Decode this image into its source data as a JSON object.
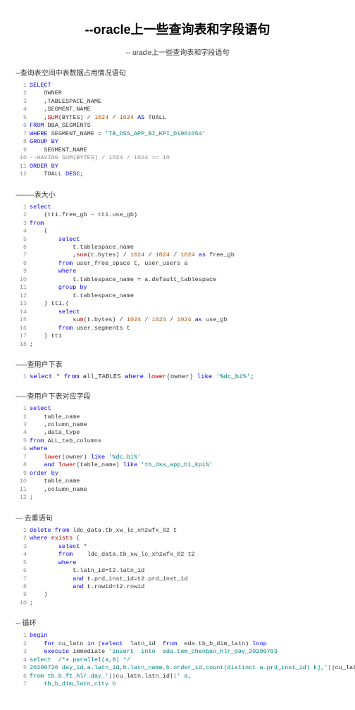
{
  "title": "--oracle上一些查询表和字段语句",
  "subtitle": "-- oracle上一些查询表和字段语句",
  "sections": {
    "s1_header": "--查询表空间中表数据占用情况语句",
    "s1_lines": [
      {
        "n": "1",
        "parts": [
          {
            "c": "kw",
            "t": "SELECT"
          }
        ]
      },
      {
        "n": "2",
        "parts": [
          {
            "c": "plain",
            "t": "    OWNER"
          }
        ]
      },
      {
        "n": "3",
        "parts": [
          {
            "c": "plain",
            "t": "    ,TABLESPACE_NAME"
          }
        ]
      },
      {
        "n": "4",
        "parts": [
          {
            "c": "plain",
            "t": "    ,SEGMENT_NAME"
          }
        ]
      },
      {
        "n": "5",
        "parts": [
          {
            "c": "plain",
            "t": "    ,"
          },
          {
            "c": "fn",
            "t": "SUM"
          },
          {
            "c": "plain",
            "t": "(BYTES) / "
          },
          {
            "c": "num",
            "t": "1024"
          },
          {
            "c": "plain",
            "t": " / "
          },
          {
            "c": "num",
            "t": "1024"
          },
          {
            "c": "plain",
            "t": " "
          },
          {
            "c": "kw",
            "t": "AS"
          },
          {
            "c": "plain",
            "t": " TOALL"
          }
        ]
      },
      {
        "n": "6",
        "parts": [
          {
            "c": "kw",
            "t": "FROM"
          },
          {
            "c": "plain",
            "t": " DBA_SEGMENTS"
          }
        ]
      },
      {
        "n": "7",
        "parts": [
          {
            "c": "kw",
            "t": "WHERE"
          },
          {
            "c": "plain",
            "t": " SEGMENT_NAME = "
          },
          {
            "c": "str",
            "t": "'TB_DSS_APP_BI_KPI_D1901054'"
          }
        ]
      },
      {
        "n": "8",
        "parts": [
          {
            "c": "kw",
            "t": "GROUP BY"
          }
        ]
      },
      {
        "n": "9",
        "parts": [
          {
            "c": "plain",
            "t": "    SEGMENT_NAME"
          }
        ]
      },
      {
        "n": "10",
        "parts": [
          {
            "c": "comment",
            "t": "--HAVING SUM(BYTES) / 1024 / 1024 >= 10"
          }
        ]
      },
      {
        "n": "11",
        "parts": [
          {
            "c": "kw",
            "t": "ORDER BY"
          }
        ]
      },
      {
        "n": "12",
        "parts": [
          {
            "c": "plain",
            "t": "    TOALL "
          },
          {
            "c": "kw",
            "t": "DESC"
          },
          {
            "c": "plain",
            "t": ";"
          }
        ]
      }
    ],
    "s2_header": "--------表大小",
    "s2_lines": [
      {
        "n": "1",
        "parts": [
          {
            "c": "kw",
            "t": "select"
          }
        ]
      },
      {
        "n": "2",
        "parts": [
          {
            "c": "plain",
            "t": "    (tt1.free_gb – tt1.use_gb)"
          }
        ]
      },
      {
        "n": "3",
        "parts": [
          {
            "c": "kw",
            "t": "from"
          }
        ]
      },
      {
        "n": "4",
        "parts": [
          {
            "c": "plain",
            "t": "    ("
          }
        ]
      },
      {
        "n": "5",
        "parts": [
          {
            "c": "plain",
            "t": "        "
          },
          {
            "c": "kw",
            "t": "select"
          }
        ]
      },
      {
        "n": "6",
        "parts": [
          {
            "c": "plain",
            "t": "            t.tablespace_name"
          }
        ]
      },
      {
        "n": "7",
        "parts": [
          {
            "c": "plain",
            "t": "            ,"
          },
          {
            "c": "fn",
            "t": "sum"
          },
          {
            "c": "plain",
            "t": "(t.bytes) / "
          },
          {
            "c": "num",
            "t": "1024"
          },
          {
            "c": "plain",
            "t": " / "
          },
          {
            "c": "num",
            "t": "1024"
          },
          {
            "c": "plain",
            "t": " / "
          },
          {
            "c": "num",
            "t": "1024"
          },
          {
            "c": "plain",
            "t": " "
          },
          {
            "c": "kw",
            "t": "as"
          },
          {
            "c": "plain",
            "t": " free_gb"
          }
        ]
      },
      {
        "n": "8",
        "parts": [
          {
            "c": "plain",
            "t": "        "
          },
          {
            "c": "kw",
            "t": "from"
          },
          {
            "c": "plain",
            "t": " user_free_space t, user_users a"
          }
        ]
      },
      {
        "n": "9",
        "parts": [
          {
            "c": "plain",
            "t": "        "
          },
          {
            "c": "kw",
            "t": "where"
          }
        ]
      },
      {
        "n": "10",
        "parts": [
          {
            "c": "plain",
            "t": "            t.tablespace_name = a.default_tablespace"
          }
        ]
      },
      {
        "n": "11",
        "parts": [
          {
            "c": "plain",
            "t": "        "
          },
          {
            "c": "kw",
            "t": "group by"
          }
        ]
      },
      {
        "n": "12",
        "parts": [
          {
            "c": "plain",
            "t": "            t.tablespace_name"
          }
        ]
      },
      {
        "n": "13",
        "parts": [
          {
            "c": "plain",
            "t": "    ) tt1,("
          }
        ]
      },
      {
        "n": "14",
        "parts": [
          {
            "c": "plain",
            "t": "        "
          },
          {
            "c": "kw",
            "t": "select"
          }
        ]
      },
      {
        "n": "15",
        "parts": [
          {
            "c": "plain",
            "t": "            "
          },
          {
            "c": "fn",
            "t": "sum"
          },
          {
            "c": "plain",
            "t": "(t.bytes) / "
          },
          {
            "c": "num",
            "t": "1024"
          },
          {
            "c": "plain",
            "t": " / "
          },
          {
            "c": "num",
            "t": "1024"
          },
          {
            "c": "plain",
            "t": " / "
          },
          {
            "c": "num",
            "t": "1024"
          },
          {
            "c": "plain",
            "t": " "
          },
          {
            "c": "kw",
            "t": "as"
          },
          {
            "c": "plain",
            "t": " use_gb"
          }
        ]
      },
      {
        "n": "16",
        "parts": [
          {
            "c": "plain",
            "t": "        "
          },
          {
            "c": "kw",
            "t": "from"
          },
          {
            "c": "plain",
            "t": " user_segments t"
          }
        ]
      },
      {
        "n": "17",
        "parts": [
          {
            "c": "plain",
            "t": "    ) tt1"
          }
        ]
      },
      {
        "n": "18",
        "parts": [
          {
            "c": "plain",
            "t": ";"
          }
        ]
      }
    ],
    "s3_header": "-----查用户下表",
    "s3_query_parts": [
      {
        "c": "ln",
        "t": "1 "
      },
      {
        "c": "kw",
        "t": "select"
      },
      {
        "c": "plain",
        "t": " * "
      },
      {
        "c": "kw",
        "t": "from"
      },
      {
        "c": "plain",
        "t": " all_TABLES "
      },
      {
        "c": "kw",
        "t": "where"
      },
      {
        "c": "plain",
        "t": " "
      },
      {
        "c": "fn",
        "t": "lower"
      },
      {
        "c": "plain",
        "t": "(owner) "
      },
      {
        "c": "kw",
        "t": "like"
      },
      {
        "c": "plain",
        "t": " "
      },
      {
        "c": "str",
        "t": "'%dc_bi%'"
      },
      {
        "c": "plain",
        "t": ";"
      }
    ],
    "s4_header": "-----查用户下表对应字段",
    "s4_lines": [
      {
        "n": "1",
        "parts": [
          {
            "c": "kw",
            "t": "select"
          }
        ]
      },
      {
        "n": "2",
        "parts": [
          {
            "c": "plain",
            "t": "    table_name"
          }
        ]
      },
      {
        "n": "3",
        "parts": [
          {
            "c": "plain",
            "t": "    ,column_name"
          }
        ]
      },
      {
        "n": "4",
        "parts": [
          {
            "c": "plain",
            "t": "    ,data_type"
          }
        ]
      },
      {
        "n": "5",
        "parts": [
          {
            "c": "kw",
            "t": "from"
          },
          {
            "c": "plain",
            "t": " ALL_tab_columns"
          }
        ]
      },
      {
        "n": "6",
        "parts": [
          {
            "c": "kw",
            "t": "where"
          }
        ]
      },
      {
        "n": "7",
        "parts": [
          {
            "c": "plain",
            "t": "    "
          },
          {
            "c": "fn",
            "t": "lower"
          },
          {
            "c": "plain",
            "t": "(owner) "
          },
          {
            "c": "kw",
            "t": "like"
          },
          {
            "c": "plain",
            "t": " "
          },
          {
            "c": "str",
            "t": "'%dc_bi%'"
          }
        ]
      },
      {
        "n": "8",
        "parts": [
          {
            "c": "plain",
            "t": "    "
          },
          {
            "c": "kw",
            "t": "and"
          },
          {
            "c": "plain",
            "t": " "
          },
          {
            "c": "fn",
            "t": "lower"
          },
          {
            "c": "plain",
            "t": "(table_name) "
          },
          {
            "c": "kw",
            "t": "like"
          },
          {
            "c": "plain",
            "t": " "
          },
          {
            "c": "str",
            "t": "'tb_dss_app_bi_kpi%'"
          }
        ]
      },
      {
        "n": "9",
        "parts": [
          {
            "c": "kw",
            "t": "order by"
          }
        ]
      },
      {
        "n": "10",
        "parts": [
          {
            "c": "plain",
            "t": "    table_name"
          }
        ]
      },
      {
        "n": "11",
        "parts": [
          {
            "c": "plain",
            "t": "    ,column_name"
          }
        ]
      },
      {
        "n": "12",
        "parts": [
          {
            "c": "plain",
            "t": ";"
          }
        ]
      }
    ],
    "s5_header": "--- 去重语句",
    "s5_lines": [
      {
        "n": "1",
        "parts": [
          {
            "c": "kw",
            "t": "delete from"
          },
          {
            "c": "plain",
            "t": " ldc_data.tb_xw_lc_xhzwfx_02 t"
          }
        ]
      },
      {
        "n": "2",
        "parts": [
          {
            "c": "kw",
            "t": "where"
          },
          {
            "c": "plain",
            "t": " "
          },
          {
            "c": "fn",
            "t": "exists"
          },
          {
            "c": "plain",
            "t": " ("
          }
        ]
      },
      {
        "n": "3",
        "parts": [
          {
            "c": "plain",
            "t": "        "
          },
          {
            "c": "kw",
            "t": "select"
          },
          {
            "c": "plain",
            "t": " *"
          }
        ]
      },
      {
        "n": "4",
        "parts": [
          {
            "c": "plain",
            "t": "        "
          },
          {
            "c": "kw",
            "t": "from"
          },
          {
            "c": "plain",
            "t": "    ldc_data.tb_xw_lc_xhzwfx_02 t2"
          }
        ]
      },
      {
        "n": "5",
        "parts": [
          {
            "c": "plain",
            "t": "        "
          },
          {
            "c": "kw",
            "t": "where"
          }
        ]
      },
      {
        "n": "6",
        "parts": [
          {
            "c": "plain",
            "t": "            t.latn_id=t2.latn_id"
          }
        ]
      },
      {
        "n": "7",
        "parts": [
          {
            "c": "plain",
            "t": "            "
          },
          {
            "c": "kw",
            "t": "and"
          },
          {
            "c": "plain",
            "t": " t.prd_inst_id=t2.prd_inst_id"
          }
        ]
      },
      {
        "n": "8",
        "parts": [
          {
            "c": "plain",
            "t": "            "
          },
          {
            "c": "kw",
            "t": "and"
          },
          {
            "c": "plain",
            "t": " t.rowid<t2.rowid"
          }
        ]
      },
      {
        "n": "9",
        "parts": [
          {
            "c": "plain",
            "t": "    )"
          }
        ]
      },
      {
        "n": "10",
        "parts": [
          {
            "c": "plain",
            "t": ";"
          }
        ]
      }
    ],
    "s6_header": "--   循环",
    "s6_lines": [
      {
        "n": "1",
        "parts": [
          {
            "c": "kw",
            "t": "begin"
          }
        ]
      },
      {
        "n": "2",
        "parts": [
          {
            "c": "plain",
            "t": "    "
          },
          {
            "c": "kw",
            "t": "for"
          },
          {
            "c": "plain",
            "t": " cu_latn "
          },
          {
            "c": "kw",
            "t": "in"
          },
          {
            "c": "plain",
            "t": " ("
          },
          {
            "c": "kw",
            "t": "select"
          },
          {
            "c": "plain",
            "t": "  latn_id  "
          },
          {
            "c": "kw",
            "t": "from"
          },
          {
            "c": "plain",
            "t": "  eda.tb_b_dim_latn) "
          },
          {
            "c": "kw",
            "t": "loop"
          }
        ]
      },
      {
        "n": "3",
        "parts": [
          {
            "c": "plain",
            "t": "    "
          },
          {
            "c": "kw",
            "t": "execute"
          },
          {
            "c": "plain",
            "t": " immediate "
          },
          {
            "c": "str",
            "t": "'insert  into  eda.tem_chenbao_hlr_day_20200703"
          }
        ]
      },
      {
        "n": "4",
        "parts": [
          {
            "c": "str",
            "t": "select  /*+ parallel(a,8) */"
          }
        ]
      },
      {
        "n": "5",
        "parts": [
          {
            "c": "str",
            "t": "20200720 day_id,a.latn_id,b.latn_name,b.order_id,count(distinct a.prd_inst_id) kj,'"
          },
          {
            "c": "plain",
            "t": "||cu_latn.latn_id||"
          },
          {
            "c": "str",
            "t": "' old_latn_id"
          }
        ]
      },
      {
        "n": "6",
        "parts": [
          {
            "c": "str",
            "t": "from tb_b_ft_hlr_day_'"
          },
          {
            "c": "plain",
            "t": "||cu_latn.latn_id||"
          },
          {
            "c": "str",
            "t": "' a,"
          }
        ]
      },
      {
        "n": "7",
        "parts": [
          {
            "c": "str",
            "t": "    tb_b_dim_latn_city b"
          }
        ]
      }
    ]
  }
}
